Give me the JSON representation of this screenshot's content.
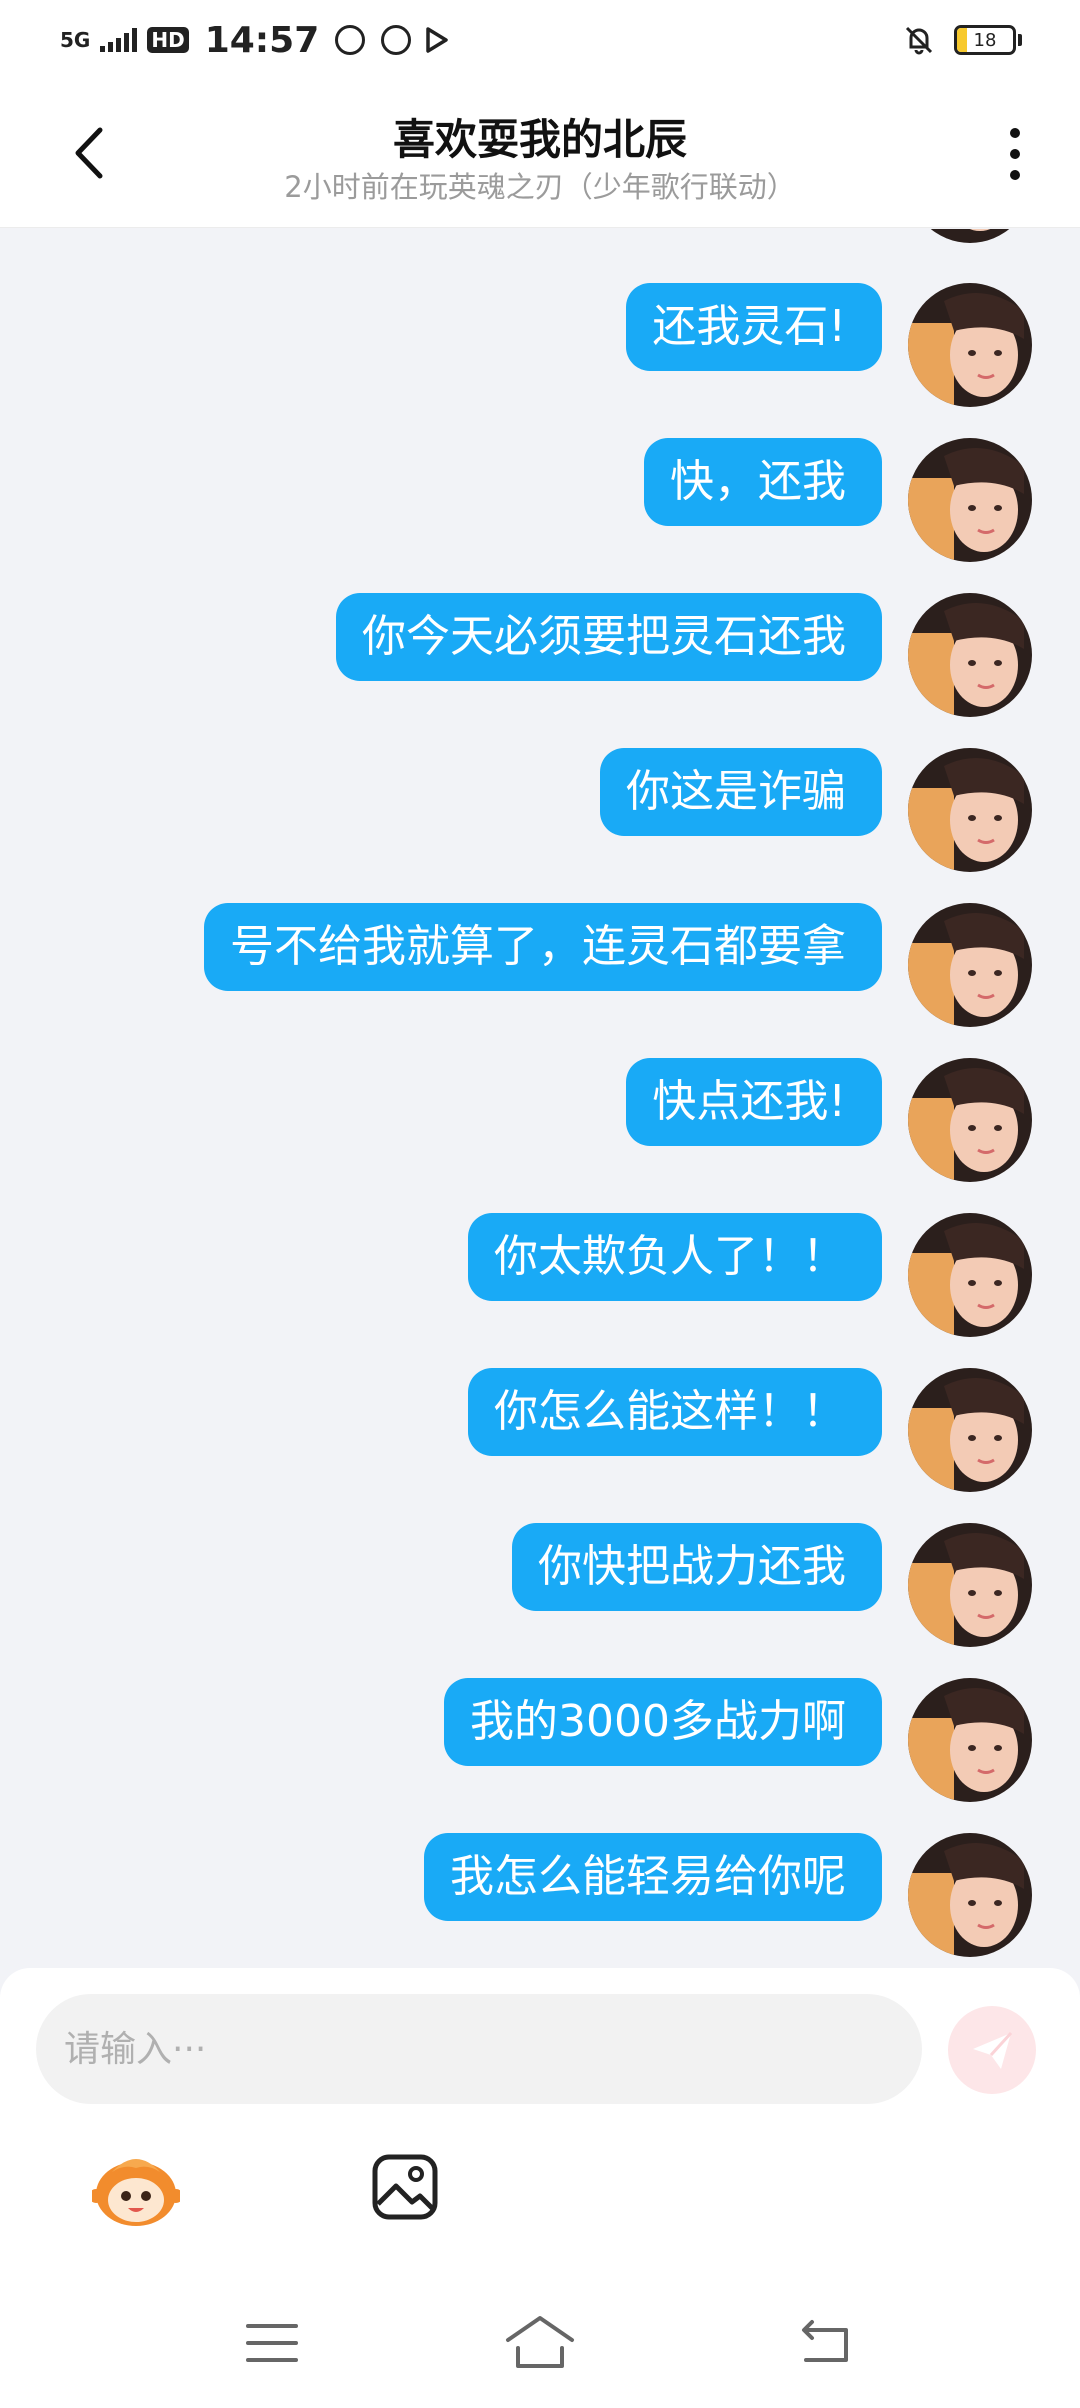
{
  "status_bar": {
    "network": "5G",
    "hd": "HD",
    "time": "14:57",
    "battery": "18",
    "battery_level": 0.18,
    "icons": [
      "signal-icon",
      "app-notification-icon",
      "mute-bell-icon",
      "battery-icon"
    ]
  },
  "header": {
    "title": "喜欢耍我的北辰",
    "subtitle": "2小时前在玩英魂之刃（少年歌行联动）",
    "back_icon": "chevron-left-icon",
    "more_icon": "more-vertical-icon"
  },
  "messages": [
    {
      "text": "还我灵石!"
    },
    {
      "text": "快，还我"
    },
    {
      "text": "你今天必须要把灵石还我"
    },
    {
      "text": "你这是诈骗"
    },
    {
      "text": "号不给我就算了，连灵石都要拿"
    },
    {
      "text": "快点还我!"
    },
    {
      "text": "你太欺负人了！！"
    },
    {
      "text": "你怎么能这样！！"
    },
    {
      "text": "你快把战力还我"
    },
    {
      "text": "我的3000多战力啊"
    },
    {
      "text": "我怎么能轻易给你呢"
    }
  ],
  "composer": {
    "placeholder": "请输入···",
    "send_icon": "send-icon",
    "emoji_icon": "mascot-emoji-icon",
    "image_icon": "image-icon"
  },
  "nav": {
    "menu_icon": "menu-icon",
    "home_icon": "home-icon",
    "back_icon": "back-arrow-icon"
  },
  "colors": {
    "bubble": "#19aaf6",
    "background": "#f2f3f7",
    "send_button": "#fde6e8",
    "mascot": "#f28c2d"
  }
}
